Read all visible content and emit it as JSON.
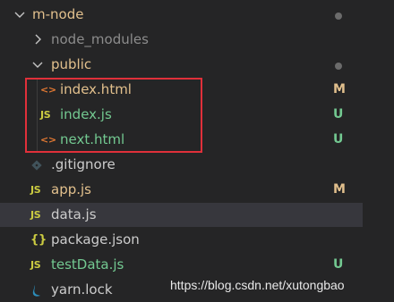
{
  "colors": {
    "background": "#252526",
    "selected_row": "#37373d",
    "modified_text": "#e2c08d",
    "untracked_text": "#73c991",
    "html_icon": "#e37933",
    "js_icon": "#cbcb41",
    "json_icon": "#cbcb41",
    "highlight_box": "#e0303a"
  },
  "tree": {
    "root": {
      "label": "m-node",
      "expanded": true
    },
    "node_modules": {
      "label": "node_modules",
      "expanded": false
    },
    "public": {
      "label": "public",
      "expanded": true,
      "children": [
        {
          "label": "index.html",
          "icon": "html-icon",
          "icon_glyph": "<>",
          "status": "M"
        },
        {
          "label": "index.js",
          "icon": "js-icon",
          "icon_glyph": "JS",
          "status": "U"
        },
        {
          "label": "next.html",
          "icon": "html-icon",
          "icon_glyph": "<>",
          "status": "U"
        }
      ]
    },
    "files": [
      {
        "label": ".gitignore",
        "icon": "git-icon",
        "status": ""
      },
      {
        "label": "app.js",
        "icon": "js-icon",
        "icon_glyph": "JS",
        "status": "M"
      },
      {
        "label": "data.js",
        "icon": "js-icon",
        "icon_glyph": "JS",
        "status": "",
        "selected": true
      },
      {
        "label": "package.json",
        "icon": "json-icon",
        "icon_glyph": "{}",
        "status": ""
      },
      {
        "label": "testData.js",
        "icon": "js-icon",
        "icon_glyph": "JS",
        "status": "U"
      },
      {
        "label": "yarn.lock",
        "icon": "yarn-icon",
        "status": ""
      }
    ]
  },
  "watermark": "https://blog.csdn.net/xutongbao"
}
